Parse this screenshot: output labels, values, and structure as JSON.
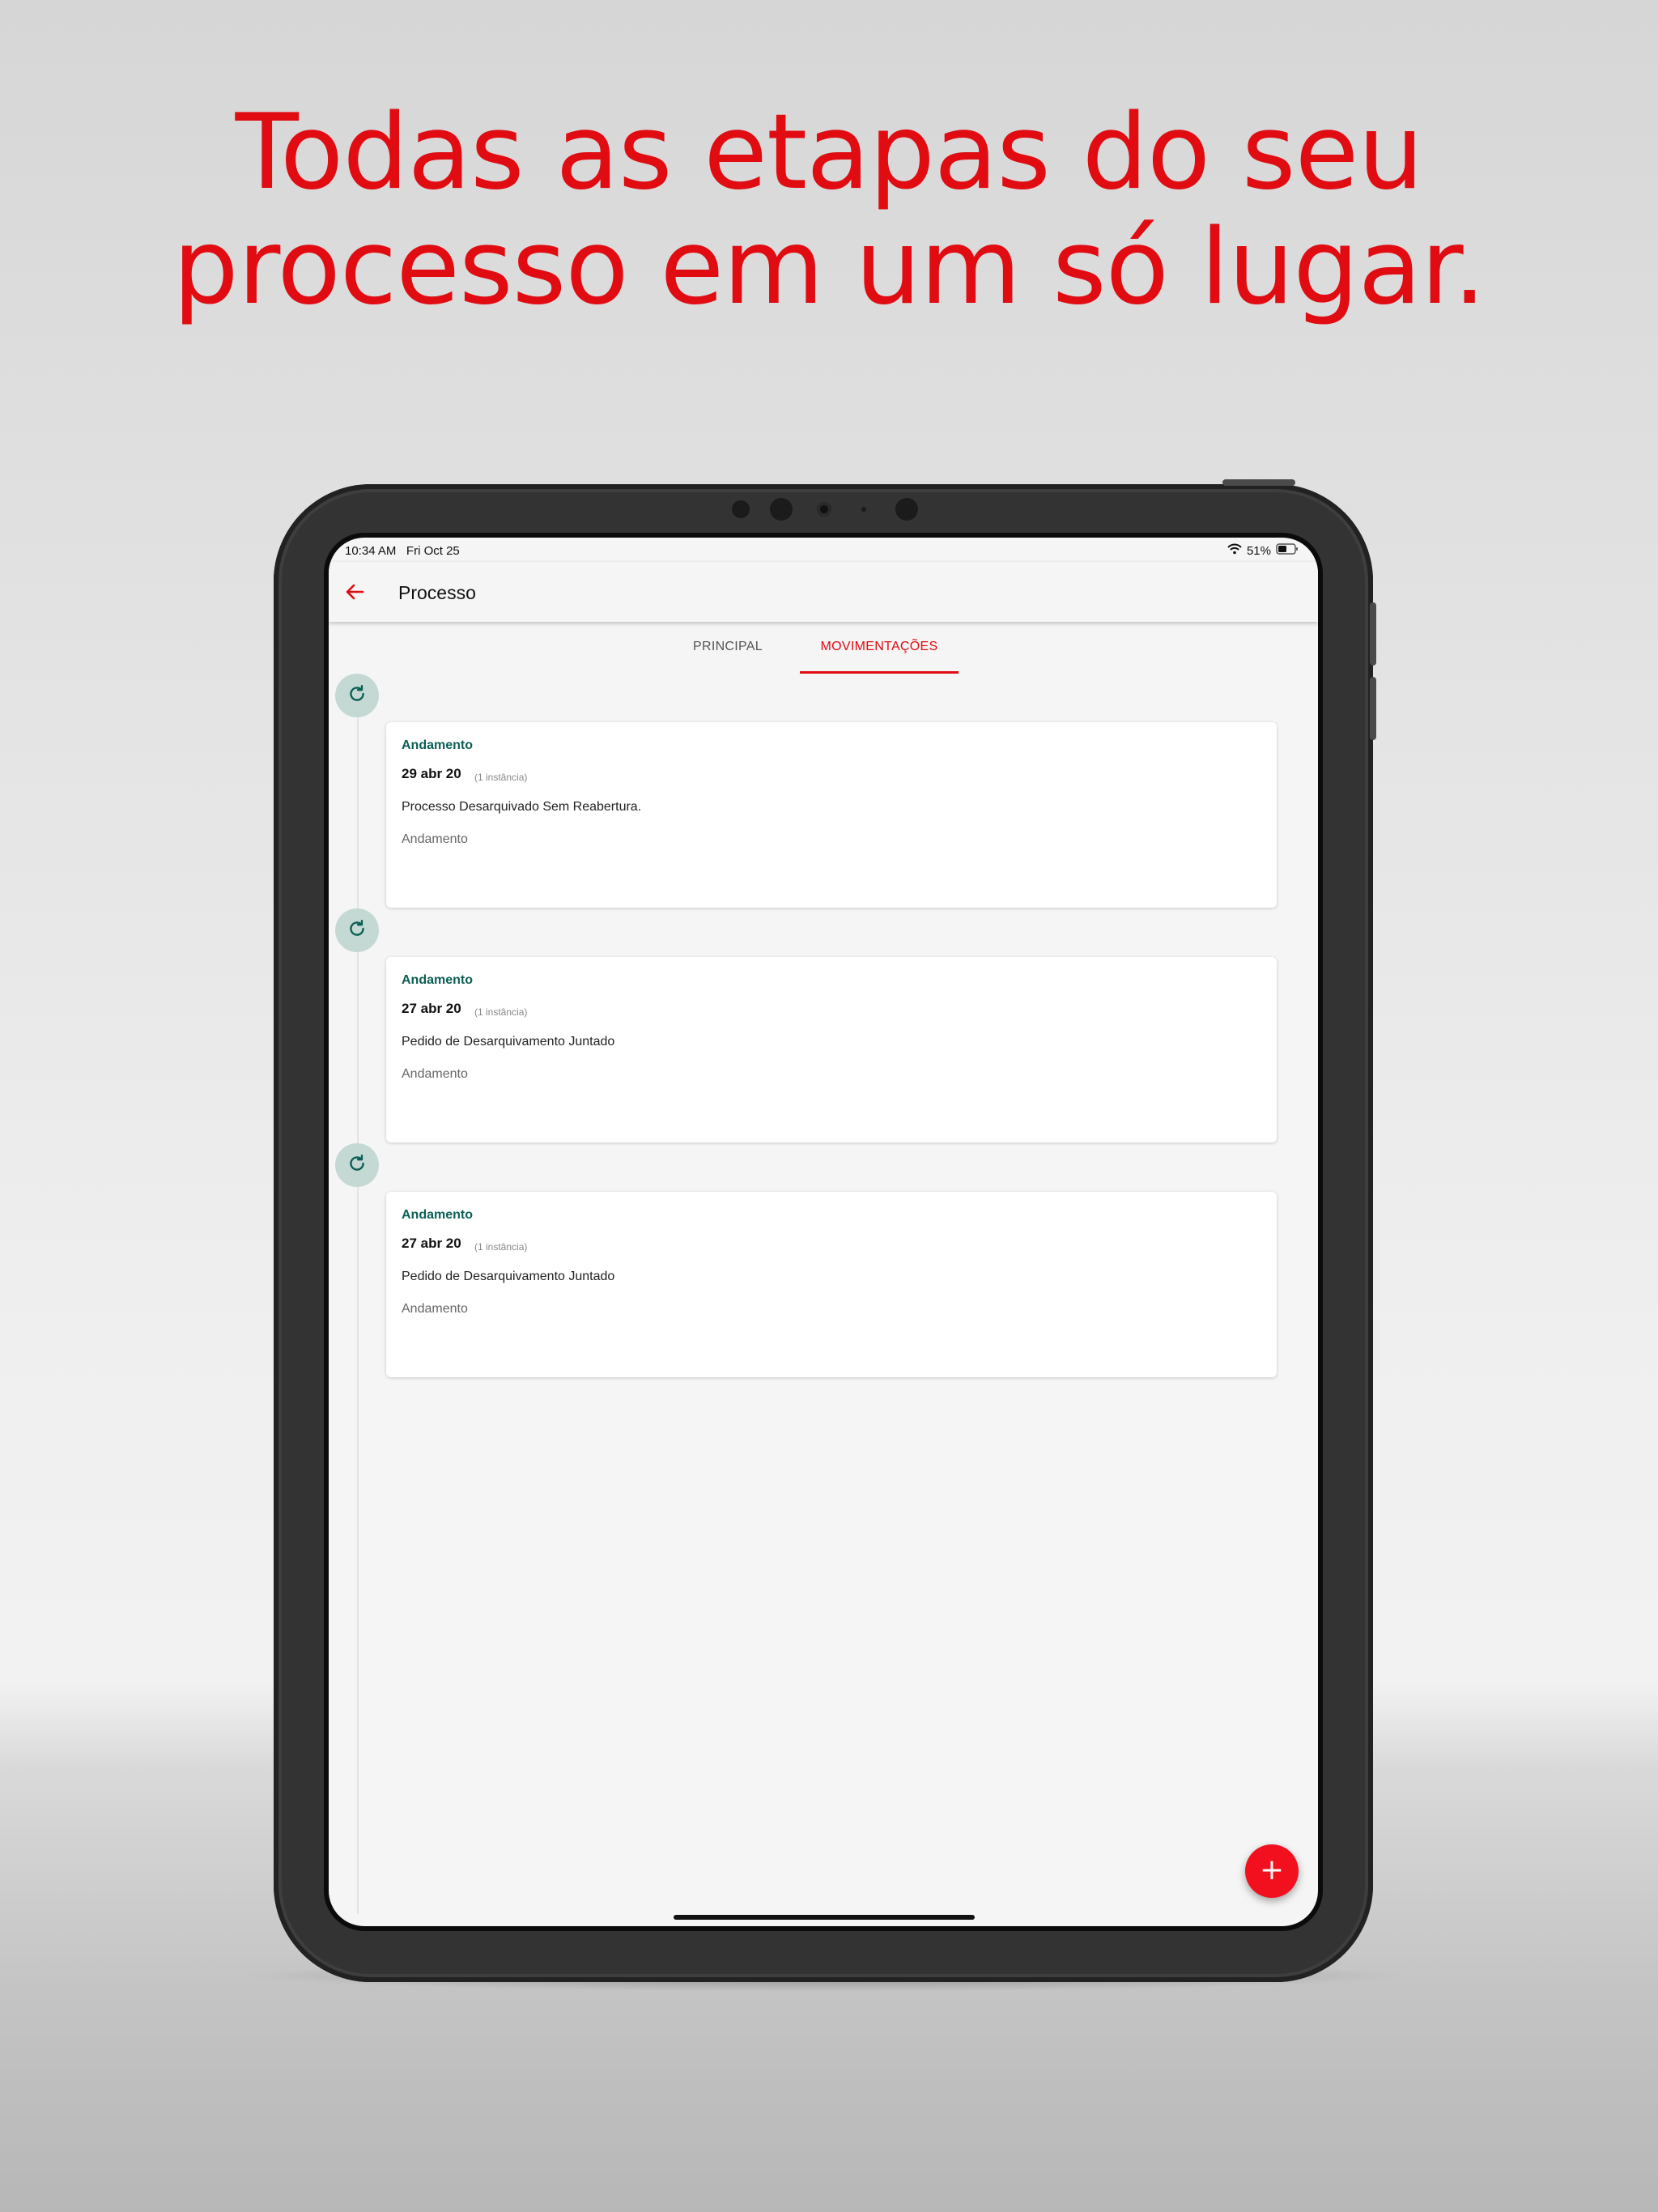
{
  "headline": {
    "line1": "Todas as etapas do seu",
    "line2": "processo em um só lugar."
  },
  "status_bar": {
    "time": "10:34 AM",
    "date": "Fri Oct 25",
    "battery": "51%"
  },
  "appbar": {
    "title": "Processo",
    "back_icon": "arrow-left-icon"
  },
  "tabs": [
    {
      "label": "PRINCIPAL",
      "active": false
    },
    {
      "label": "MOVIMENTAÇÕES",
      "active": true
    }
  ],
  "timeline": {
    "icon": "refresh-icon",
    "items": [
      {
        "type": "Andamento",
        "date": "29 abr 20",
        "instance": "(1 instância)",
        "description": "Processo Desarquivado Sem Reabertura.",
        "category": "Andamento"
      },
      {
        "type": "Andamento",
        "date": "27 abr 20",
        "instance": "(1 instância)",
        "description": "Pedido de Desarquivamento Juntado",
        "category": "Andamento"
      },
      {
        "type": "Andamento",
        "date": "27 abr 20",
        "instance": "(1 instância)",
        "description": "Pedido de Desarquivamento Juntado",
        "category": "Andamento"
      }
    ]
  },
  "fab": {
    "label": "+"
  },
  "colors": {
    "accent": "#e00c12",
    "teal": "#0c5f55",
    "timeline_icon_bg": "#c5d9d4"
  }
}
